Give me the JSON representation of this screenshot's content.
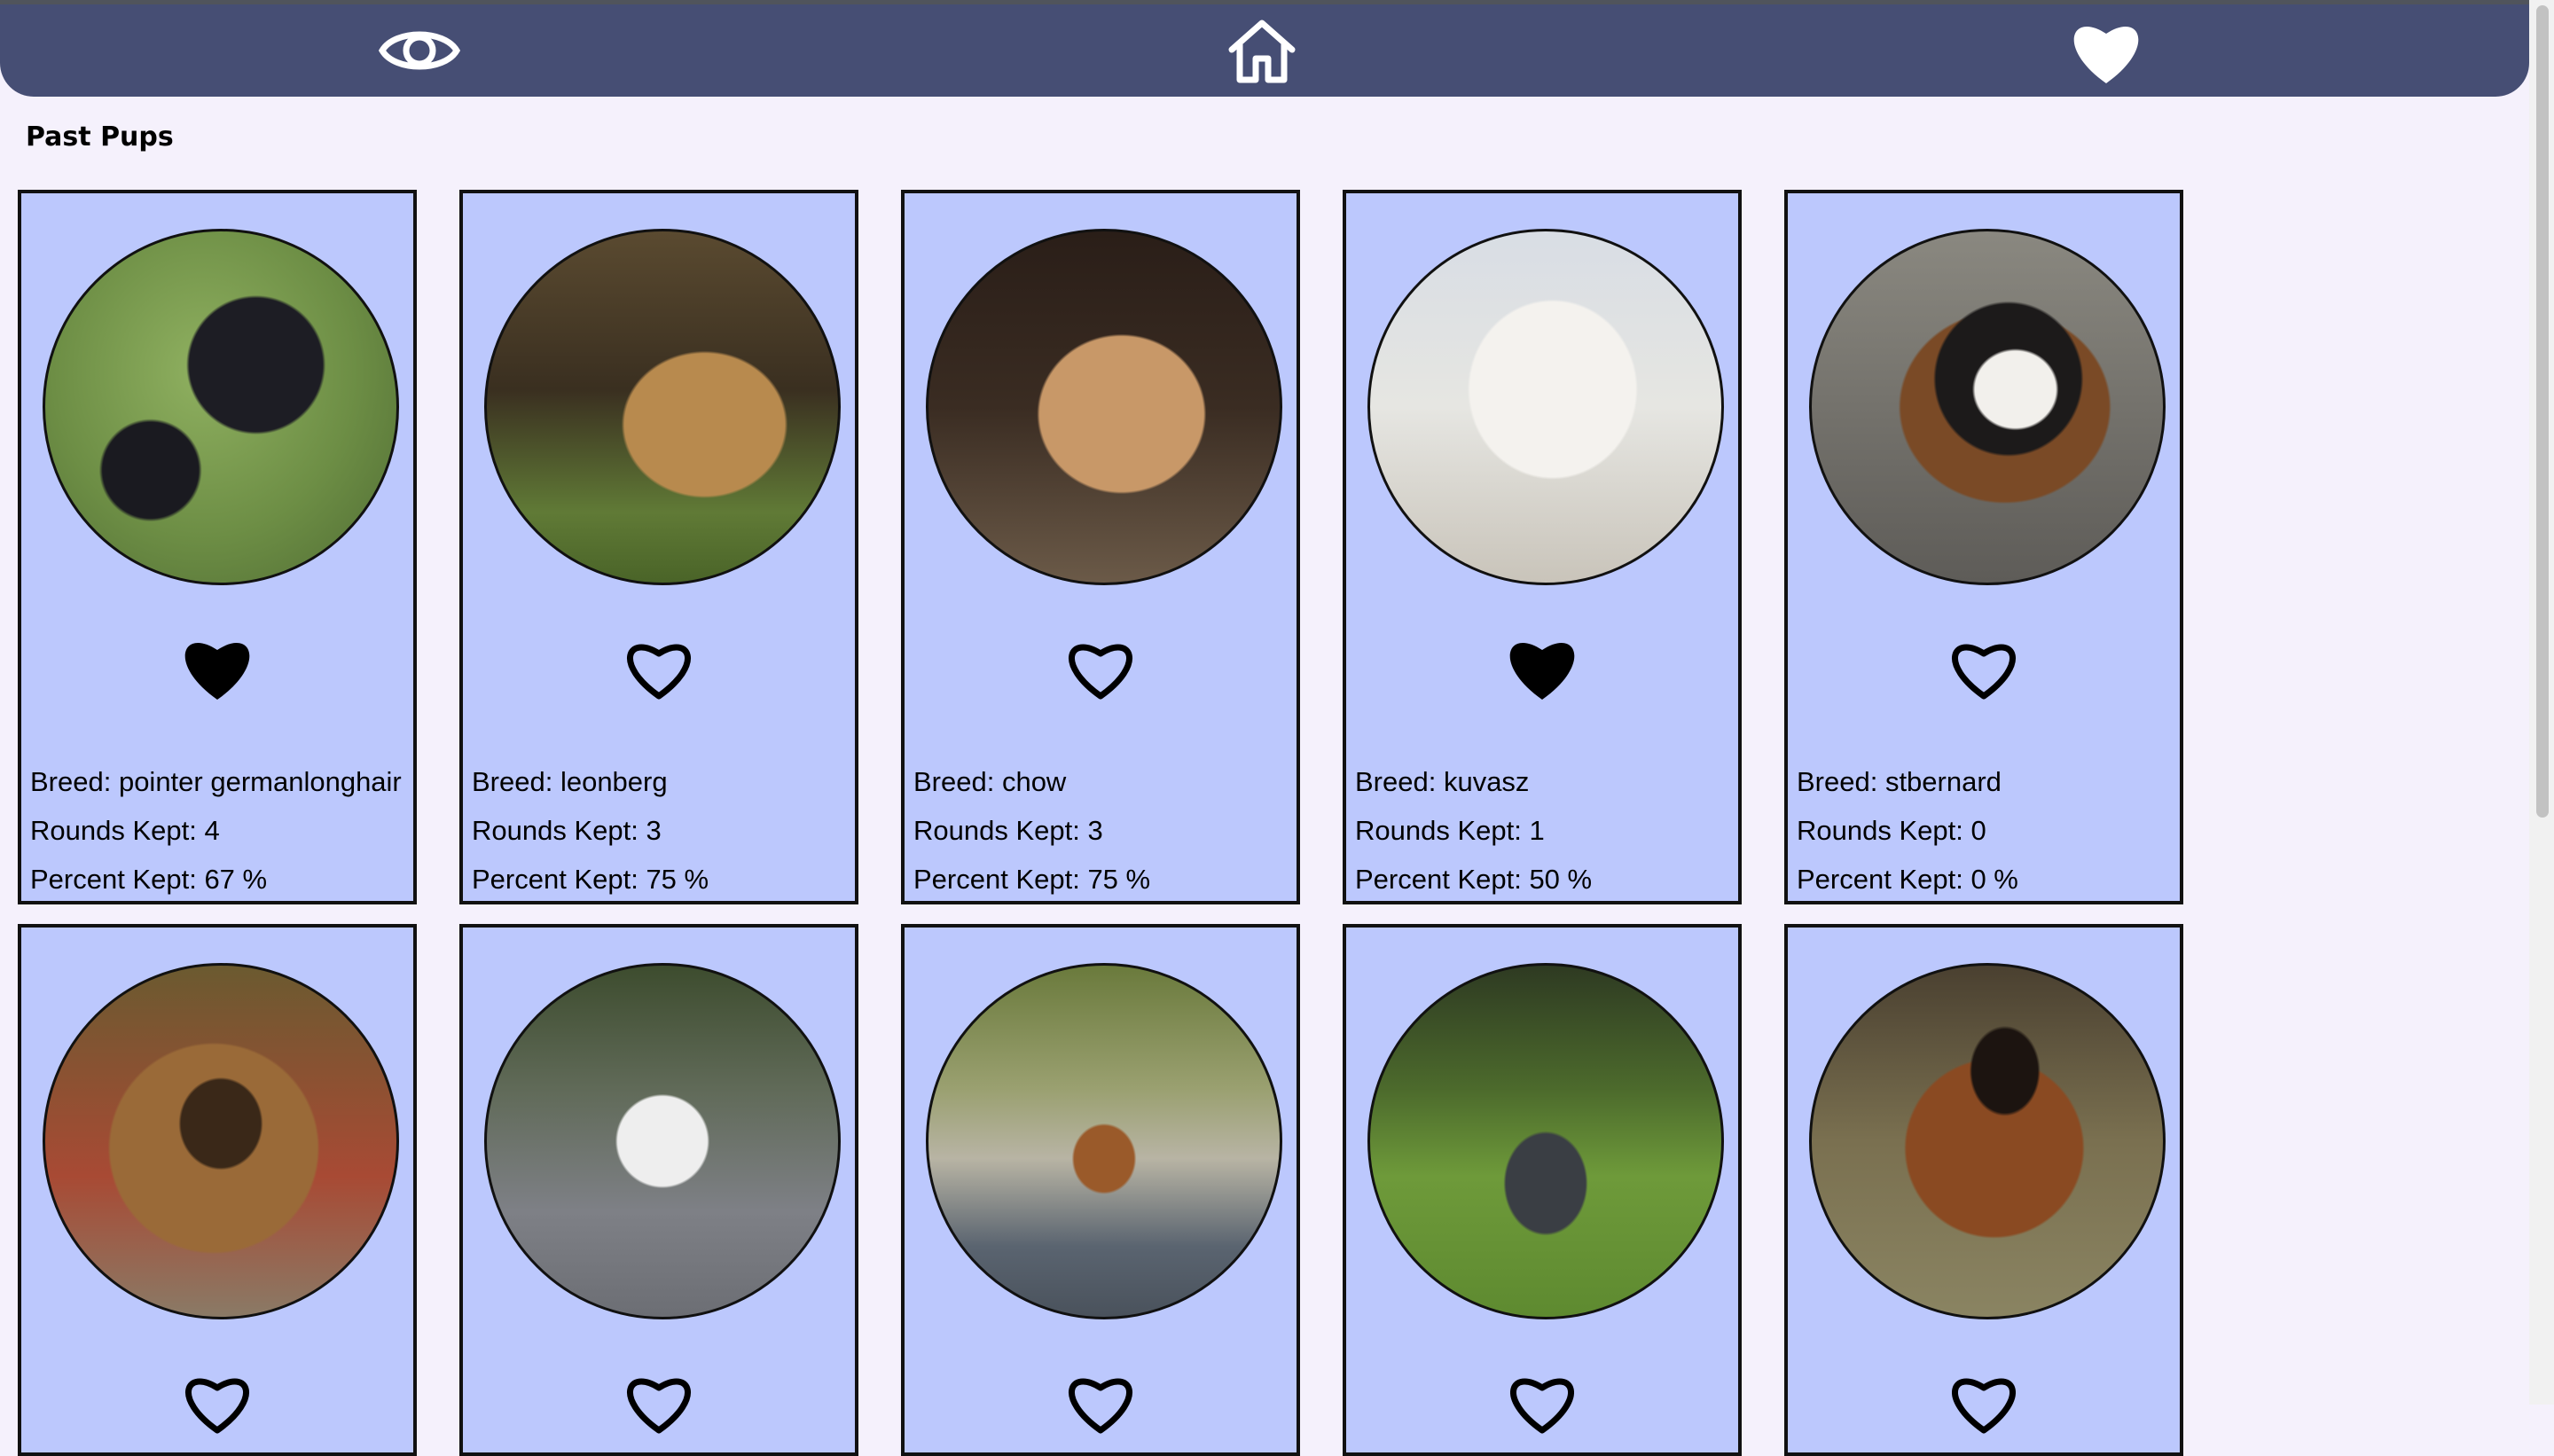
{
  "nav": {
    "items": [
      {
        "name": "seen-nav-button",
        "icon": "eye-icon"
      },
      {
        "name": "home-nav-button",
        "icon": "home-icon"
      },
      {
        "name": "favorites-nav-button",
        "icon": "heart-icon"
      }
    ]
  },
  "page": {
    "title": "Past Pups"
  },
  "colors": {
    "navbar": "#464e74",
    "card": "#bcc8fd",
    "background": "#f5f1fc"
  },
  "pups": [
    {
      "breed": "Breed: pointer germanlonghair",
      "rounds": "Rounds Kept: 4",
      "percent": "Percent Kept: 67 %",
      "favorite": true
    },
    {
      "breed": "Breed: leonberg",
      "rounds": "Rounds Kept: 3",
      "percent": "Percent Kept: 75 %",
      "favorite": false
    },
    {
      "breed": "Breed: chow",
      "rounds": "Rounds Kept: 3",
      "percent": "Percent Kept: 75 %",
      "favorite": false
    },
    {
      "breed": "Breed: kuvasz",
      "rounds": "Rounds Kept: 1",
      "percent": "Percent Kept: 50 %",
      "favorite": true
    },
    {
      "breed": "Breed: stbernard",
      "rounds": "Rounds Kept: 0",
      "percent": "Percent Kept: 0 %",
      "favorite": false
    },
    {
      "favorite": false
    },
    {
      "favorite": false
    },
    {
      "favorite": false
    },
    {
      "favorite": false
    },
    {
      "favorite": false
    }
  ]
}
